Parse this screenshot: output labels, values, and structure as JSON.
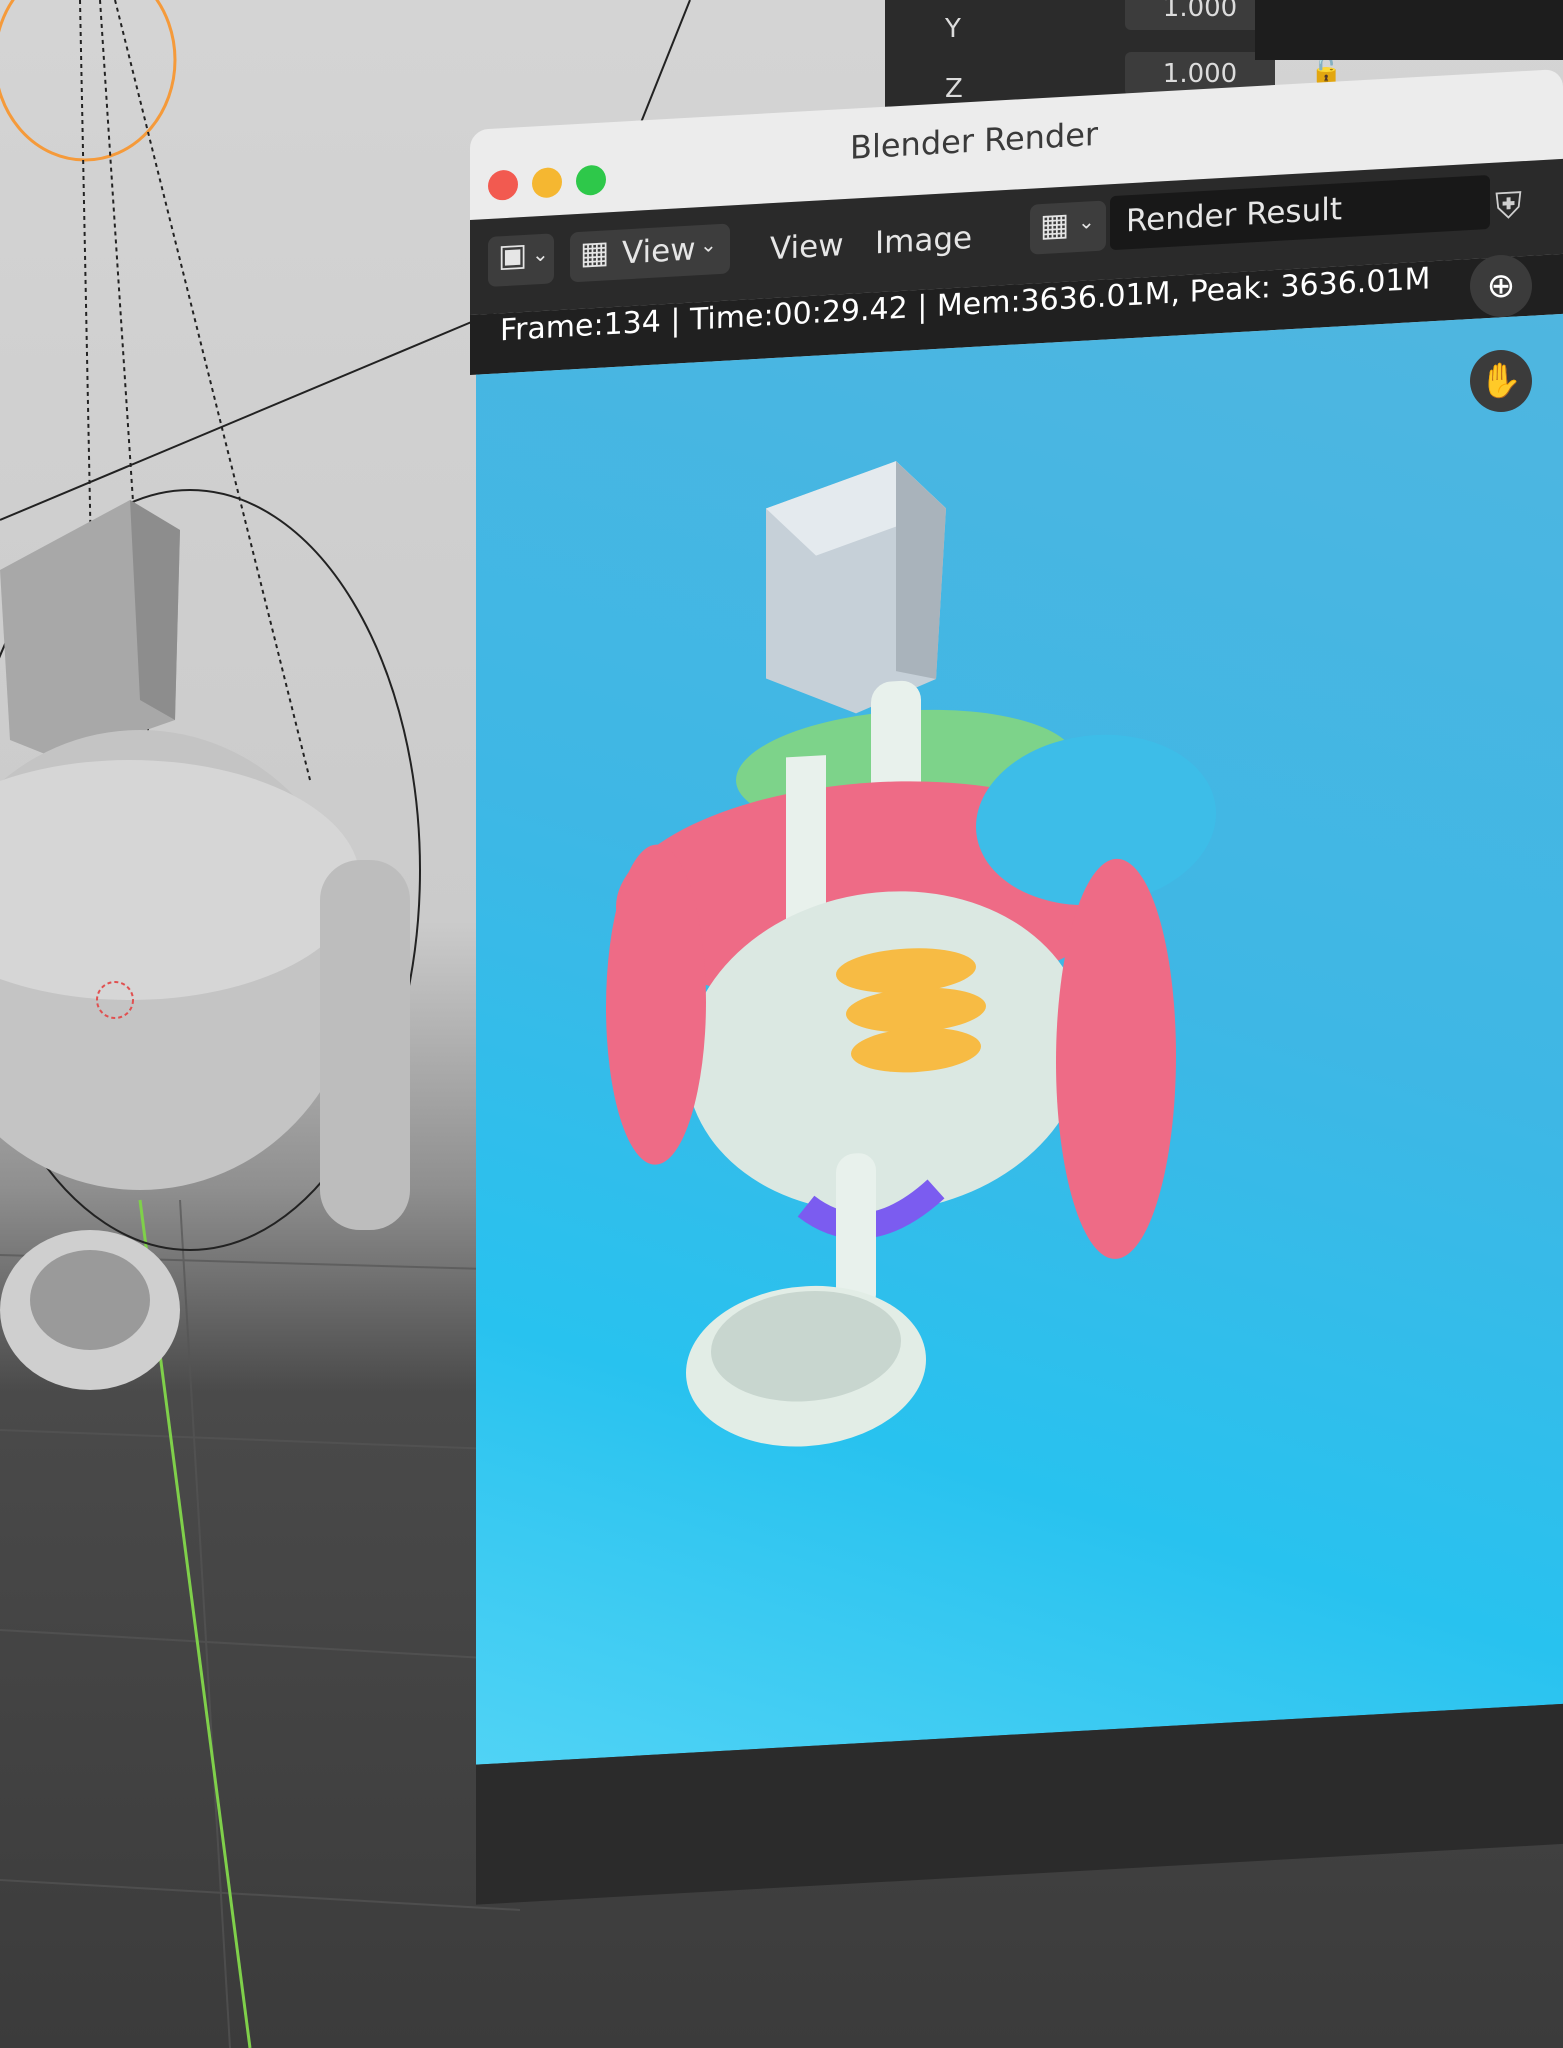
{
  "window": {
    "title": "Blender Render",
    "toolbar": {
      "editor_type_icon": "image-editor-icon",
      "view_dropdown_label": "View",
      "menu_view": "View",
      "menu_image": "Image",
      "image_browse_icon": "image-icon",
      "image_name": "Render Result",
      "shield_icon": "shield-icon",
      "duplicate_icon": "duplicate-icon"
    },
    "status": "Frame:134 | Time:00:29.42 | Mem:3636.01M, Peak: 3636.01M",
    "zoom_icon": "zoom-in-icon",
    "pan_icon": "hand-icon"
  },
  "properties": {
    "rows": [
      {
        "axis": "Y",
        "value": "1.000"
      },
      {
        "axis": "Z",
        "value": "1.000"
      }
    ]
  },
  "colors": {
    "traffic_close": "#f25a50",
    "traffic_minimize": "#f5b731",
    "traffic_zoom": "#2ec84a",
    "render_bg": "#3eb7e5",
    "muscle_red": "#ee6b86",
    "muscle_blue": "#3dbde8",
    "muscle_green": "#7dd38a",
    "rib_yellow": "#f7bb44",
    "purple": "#7b5cf0"
  }
}
